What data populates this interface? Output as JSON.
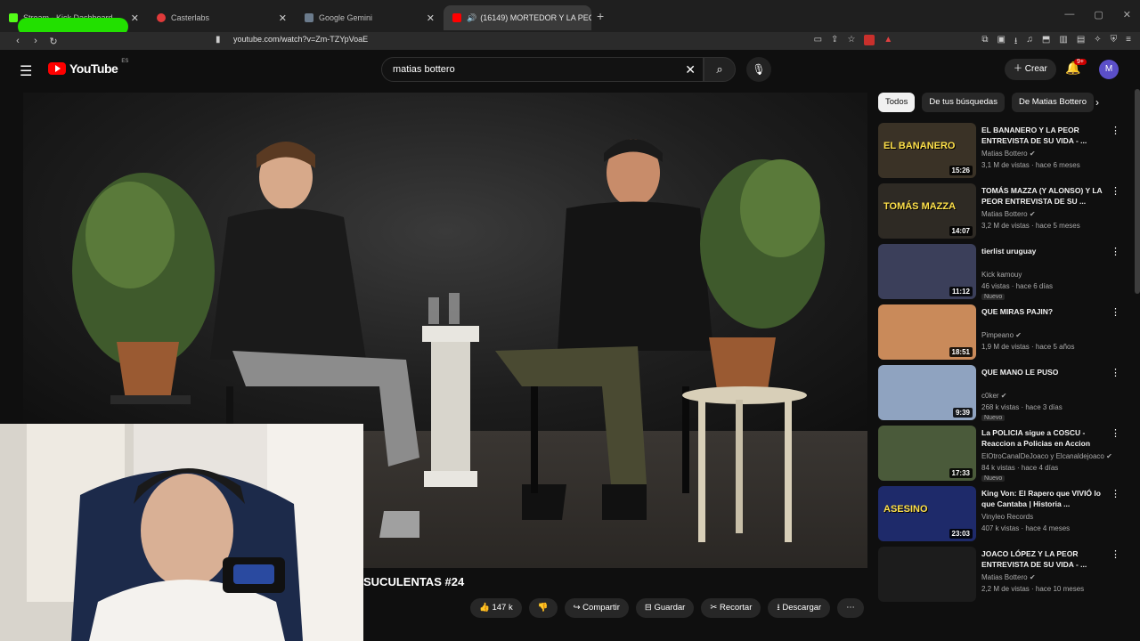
{
  "browser": {
    "tabs": [
      {
        "label": "Stream - Kick Dashboard",
        "color": "#53fc18"
      },
      {
        "label": "Casterlabs",
        "color": "#e03a3a"
      },
      {
        "label": "Google Gemini",
        "color": "#6b7b8c"
      },
      {
        "label": "(16149) MORTEDOR Y LA PEO",
        "color": "#ff0000"
      }
    ],
    "url": "youtube.com/watch?v=Zm-TZYpVoaE"
  },
  "youtube": {
    "logo": "YouTube",
    "logo_region": "ES",
    "search_value": "matias bottero",
    "create_label": "Crear",
    "notif_count": "9+",
    "avatar_letter": "M"
  },
  "video": {
    "title": "SUCULENTAS #24",
    "likes": "147 k",
    "share": "Compartir",
    "save": "Guardar",
    "clip": "Recortar",
    "download": "Descargar"
  },
  "chips": [
    "Todos",
    "De tus búsquedas",
    "De Matias Bottero"
  ],
  "recommendations": [
    {
      "title": "EL BANANERO Y LA PEOR ENTREVISTA DE SU VIDA - ...",
      "channel": "Matias Bottero",
      "verified": true,
      "meta": "3,1 M de vistas · hace 6 meses",
      "duration": "15:26",
      "badge": "",
      "thumb_color": "#3a3226",
      "thumb_text": "EL BANANERO"
    },
    {
      "title": "TOMÁS MAZZA (Y ALONSO) Y LA PEOR ENTREVISTA DE SU ...",
      "channel": "Matias Bottero",
      "verified": true,
      "meta": "3,2 M de vistas · hace 5 meses",
      "duration": "14:07",
      "badge": "",
      "thumb_color": "#2e2a24",
      "thumb_text": "TOMÁS MAZZA"
    },
    {
      "title": "tierlist uruguay",
      "channel": "Kick kamouy",
      "verified": false,
      "meta": "46 vistas · hace 6 días",
      "duration": "11:12",
      "badge": "Nuevo",
      "thumb_color": "#3b3f5a",
      "thumb_text": ""
    },
    {
      "title": "QUE MIRAS PAJIN?",
      "channel": "Pimpeano",
      "verified": true,
      "meta": "1,9 M de vistas · hace 5 años",
      "duration": "18:51",
      "badge": "",
      "thumb_color": "#c98a5a",
      "thumb_text": ""
    },
    {
      "title": "QUE MANO LE PUSO",
      "channel": "c0ker",
      "verified": true,
      "meta": "268 k vistas · hace 3 días",
      "duration": "9:39",
      "badge": "Nuevo",
      "thumb_color": "#8fa3c0",
      "thumb_text": ""
    },
    {
      "title": "La POLICIA sigue a COSCU - Reaccion a Policias en Accion",
      "channel": "ElOtroCanalDeJoaco y Elcanaldejoaco",
      "verified": true,
      "meta": "84 k vistas · hace 4 días",
      "duration": "17:33",
      "badge": "Nuevo",
      "thumb_color": "#4a5a3a",
      "thumb_text": ""
    },
    {
      "title": "King Von: El Rapero que VIVIÓ lo que Cantaba | Historia ...",
      "channel": "Vinyleo Records",
      "verified": false,
      "meta": "407 k vistas · hace 4 meses",
      "duration": "23:03",
      "badge": "",
      "thumb_color": "#1e2a6a",
      "thumb_text": "ASESINO"
    },
    {
      "title": "JOACO LÓPEZ Y LA PEOR ENTREVISTA DE SU VIDA - ...",
      "channel": "Matias Bottero",
      "verified": true,
      "meta": "2,2 M de vistas · hace 10 meses",
      "duration": "",
      "badge": "",
      "thumb_color": "#1c1c1c",
      "thumb_text": ""
    }
  ]
}
